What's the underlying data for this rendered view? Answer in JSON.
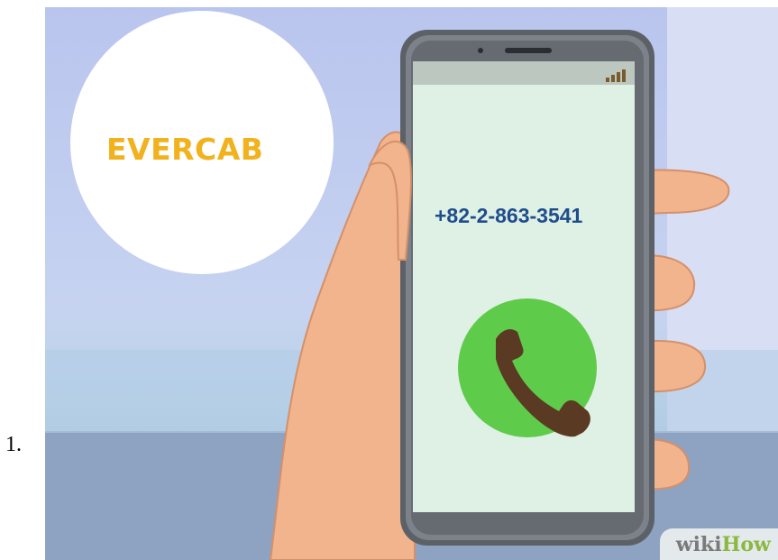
{
  "step": {
    "number": "1."
  },
  "brand": {
    "label": "EVERCAB",
    "color": "#f2b21e"
  },
  "phone": {
    "dialed_number": "+82-2-863-3541",
    "number_color": "#1f4d8c",
    "screen_color": "#dff0e4",
    "call_button_color": "#5fcb4b",
    "handset_color": "#5a3a22",
    "signal_icon": "signal-bars-icon",
    "call_icon": "phone-handset-icon"
  },
  "watermark": {
    "part_a": "wiki",
    "part_b": "How"
  }
}
